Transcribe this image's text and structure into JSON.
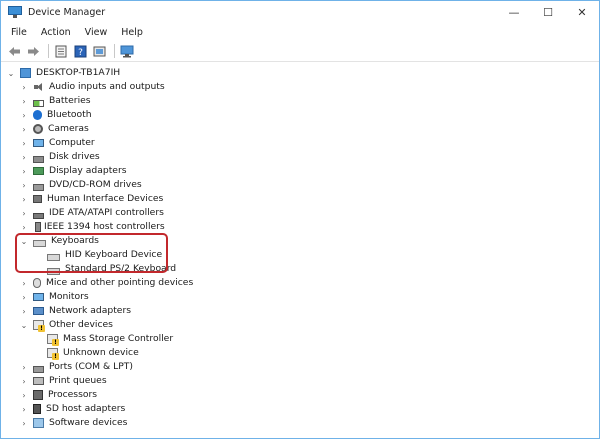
{
  "window": {
    "title": "Device Manager"
  },
  "controls": {
    "minimize": "—",
    "maximize": "☐",
    "close": "✕"
  },
  "menu": [
    "File",
    "Action",
    "View",
    "Help"
  ],
  "toolbar": [
    {
      "name": "back-arrow-icon"
    },
    {
      "name": "forward-arrow-icon"
    },
    {
      "name": "properties-icon"
    },
    {
      "name": "help-icon"
    },
    {
      "name": "update-driver-icon"
    },
    {
      "name": "scan-hardware-icon"
    }
  ],
  "tree": {
    "root": "DESKTOP-TB1A7IH",
    "items": [
      {
        "label": "Audio inputs and outputs",
        "icon": "speaker-icon",
        "expanded": false
      },
      {
        "label": "Batteries",
        "icon": "battery-icon",
        "expanded": false
      },
      {
        "label": "Bluetooth",
        "icon": "bluetooth-icon",
        "expanded": false
      },
      {
        "label": "Cameras",
        "icon": "camera-icon",
        "expanded": false
      },
      {
        "label": "Computer",
        "icon": "computer-icon",
        "expanded": false
      },
      {
        "label": "Disk drives",
        "icon": "disk-drive-icon",
        "expanded": false
      },
      {
        "label": "Display adapters",
        "icon": "display-adapter-icon",
        "expanded": false
      },
      {
        "label": "DVD/CD-ROM drives",
        "icon": "dvd-drive-icon",
        "expanded": false
      },
      {
        "label": "Human Interface Devices",
        "icon": "hid-icon",
        "expanded": false
      },
      {
        "label": "IDE ATA/ATAPI controllers",
        "icon": "ide-controller-icon",
        "expanded": false
      },
      {
        "label": "IEEE 1394 host controllers",
        "icon": "ieee1394-icon",
        "expanded": false
      },
      {
        "label": "Keyboards",
        "icon": "keyboard-icon",
        "expanded": true,
        "children": [
          "HID Keyboard Device",
          "Standard PS/2 Keyboard"
        ]
      },
      {
        "label": "Mice and other pointing devices",
        "icon": "mouse-icon",
        "expanded": false
      },
      {
        "label": "Monitors",
        "icon": "monitor-icon",
        "expanded": false
      },
      {
        "label": "Network adapters",
        "icon": "network-adapter-icon",
        "expanded": false
      },
      {
        "label": "Other devices",
        "icon": "other-devices-icon",
        "expanded": true,
        "children": [
          "Mass Storage Controller",
          "Unknown device"
        ]
      },
      {
        "label": "Ports (COM & LPT)",
        "icon": "ports-icon",
        "expanded": false
      },
      {
        "label": "Print queues",
        "icon": "printer-icon",
        "expanded": false
      },
      {
        "label": "Processors",
        "icon": "processor-icon",
        "expanded": false
      },
      {
        "label": "SD host adapters",
        "icon": "sd-card-icon",
        "expanded": false
      },
      {
        "label": "Software devices",
        "icon": "software-device-icon",
        "expanded": false
      }
    ]
  },
  "colors": {
    "highlight": "#c2282c",
    "accent": "#0078d7"
  }
}
